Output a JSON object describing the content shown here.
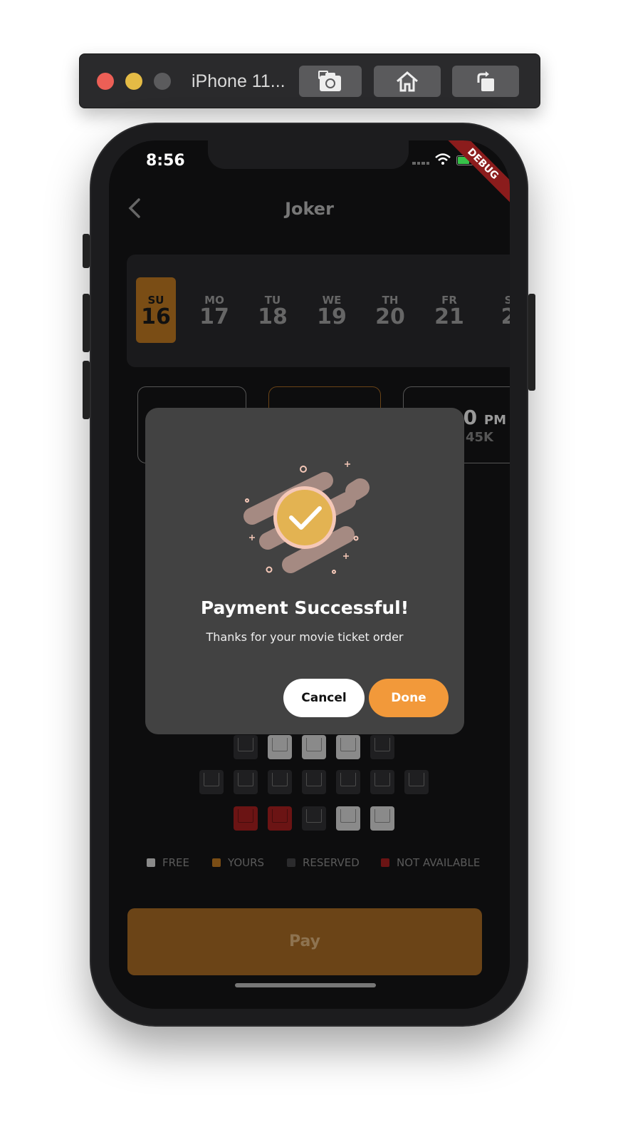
{
  "simulator": {
    "title": "iPhone 11...",
    "buttons": [
      "screenshot-icon",
      "home-icon",
      "rotate-icon"
    ]
  },
  "status_bar": {
    "time": "8:56",
    "debug_banner": "DEBUG"
  },
  "header": {
    "title": "Joker"
  },
  "dates": [
    {
      "dow": "SU",
      "day": "16",
      "selected": true
    },
    {
      "dow": "MO",
      "day": "17"
    },
    {
      "dow": "TU",
      "day": "18"
    },
    {
      "dow": "WE",
      "day": "19"
    },
    {
      "dow": "TH",
      "day": "20"
    },
    {
      "dow": "FR",
      "day": "21"
    },
    {
      "dow": "S",
      "day": "2"
    }
  ],
  "time_cards": [
    {
      "time": "0",
      "period": "PM",
      "price": "45K"
    }
  ],
  "legend": {
    "free": "FREE",
    "yours": "YOURS",
    "reserved": "RESERVED",
    "not_available": "NOT AVAILABLE"
  },
  "pay_button": "Pay",
  "dialog": {
    "title": "Payment Successful!",
    "message": "Thanks for your movie ticket order",
    "cancel": "Cancel",
    "done": "Done"
  },
  "colors": {
    "accent": "#f2993a",
    "selected_date": "#7a4d15",
    "free_seat": "#8a8a8a",
    "reserved_seat": "#1f1f21",
    "not_available_seat": "#6b1414",
    "dialog_bg": "#424242"
  }
}
